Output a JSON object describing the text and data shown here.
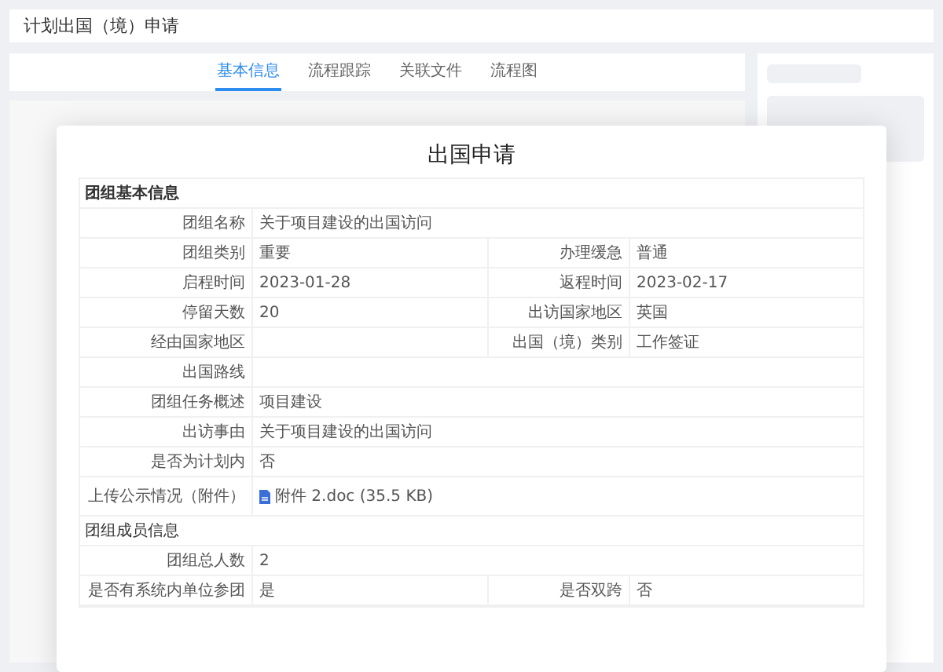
{
  "page": {
    "title": "计划出国（境）申请"
  },
  "tabs": [
    {
      "label": "基本信息",
      "selected": true
    },
    {
      "label": "流程跟踪",
      "selected": false
    },
    {
      "label": "关联文件",
      "selected": false
    },
    {
      "label": "流程图",
      "selected": false
    }
  ],
  "dialog": {
    "title": "出国申请",
    "rows": [
      {
        "kind": "section",
        "label": "团组基本信息"
      },
      {
        "kind": "full",
        "label": "团组名称",
        "value": "关于项目建设的出国访问"
      },
      {
        "kind": "pair",
        "label": "团组类别",
        "value": "重要",
        "label_2": "办理缓急",
        "value_2": "普通"
      },
      {
        "kind": "pair",
        "label": "启程时间",
        "value": "2023-01-28",
        "label_2": "返程时间",
        "value_2": "2023-02-17"
      },
      {
        "kind": "pair",
        "label": "停留天数",
        "value": "20",
        "label_2": "出访国家地区",
        "value_2": "英国"
      },
      {
        "kind": "pair",
        "label": "经由国家地区",
        "label_2": "出国（境）类别",
        "value_2": "工作签证"
      },
      {
        "kind": "full",
        "label": "出国路线"
      },
      {
        "kind": "full",
        "label": "团组任务概述",
        "value": "项目建设"
      },
      {
        "kind": "full",
        "label": "出访事由",
        "value": "关于项目建设的出国访问"
      },
      {
        "kind": "full",
        "label": "是否为计划内",
        "value": "否"
      },
      {
        "kind": "file",
        "label": "上传公示情况（附件）",
        "value": "附件 2.doc (35.5 KB)"
      },
      {
        "kind": "section",
        "label": "团组成员信息"
      },
      {
        "kind": "full",
        "label": "团组总人数",
        "value": "2"
      },
      {
        "kind": "pair",
        "label": "是否有系统内单位参团",
        "value": "是",
        "label_2": "是否双跨",
        "value_2": "否"
      }
    ]
  }
}
